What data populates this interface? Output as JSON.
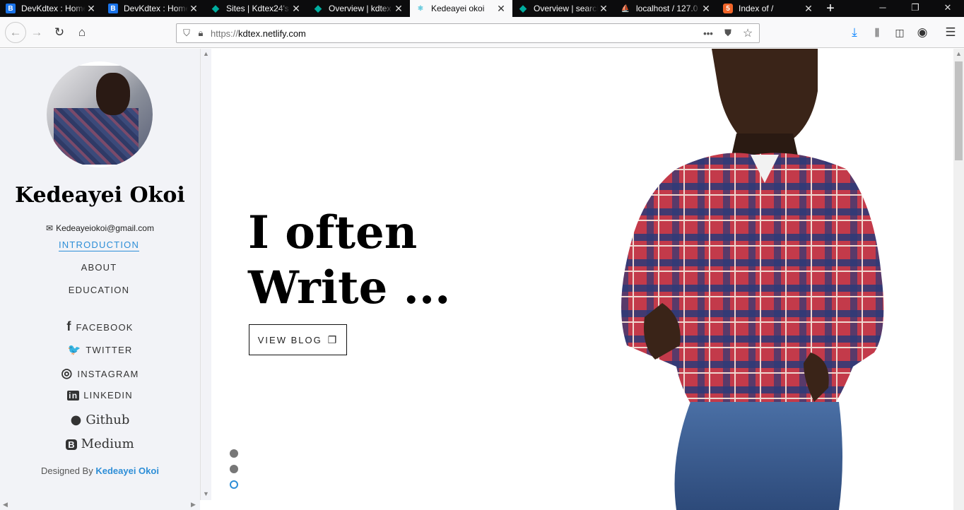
{
  "browser": {
    "tabs": [
      {
        "title": "DevKdtex : Home",
        "favicon": "B",
        "favicon_type": "b"
      },
      {
        "title": "DevKdtex : Home",
        "favicon": "B",
        "favicon_type": "b"
      },
      {
        "title": "Sites | Kdtex24's",
        "favicon": "◆",
        "favicon_type": "n"
      },
      {
        "title": "Overview | kdtex",
        "favicon": "◆",
        "favicon_type": "n"
      },
      {
        "title": "Kedeayei okoi",
        "favicon": "⚛",
        "favicon_type": "r",
        "active": true
      },
      {
        "title": "Overview | search",
        "favicon": "◆",
        "favicon_type": "n"
      },
      {
        "title": "localhost / 127.0",
        "favicon": "⛵",
        "favicon_type": "o"
      },
      {
        "title": "Index of /",
        "favicon": "5",
        "favicon_type": "h"
      }
    ],
    "url_protocol": "https://",
    "url_host": "kdtex.netlify.com"
  },
  "sidebar": {
    "name": "Kedeayei Okoi",
    "email": "Kedeayeiokoi@gmail.com",
    "nav": [
      "INTRODUCTION",
      "ABOUT",
      "EDUCATION"
    ],
    "social": [
      {
        "label": "FACEBOOK",
        "icon": "facebook-icon",
        "glyph": "f"
      },
      {
        "label": "TWITTER",
        "icon": "twitter-icon",
        "glyph": "🐦"
      },
      {
        "label": "INSTAGRAM",
        "icon": "instagram-icon",
        "glyph": "◎"
      },
      {
        "label": "LINKEDIN",
        "icon": "linkedin-icon",
        "glyph": "in"
      },
      {
        "label": "Github",
        "icon": "github-icon",
        "glyph": "●"
      },
      {
        "label": "Medium",
        "icon": "blogger-icon",
        "glyph": "B"
      }
    ],
    "designed_prefix": "Designed By",
    "designed_name": "Kedeayei Okoi"
  },
  "main": {
    "headline_line1": "I often",
    "headline_line2": "Write ...",
    "view_blog": "VIEW BLOG"
  },
  "colors": {
    "accent": "#2d8ed7"
  }
}
